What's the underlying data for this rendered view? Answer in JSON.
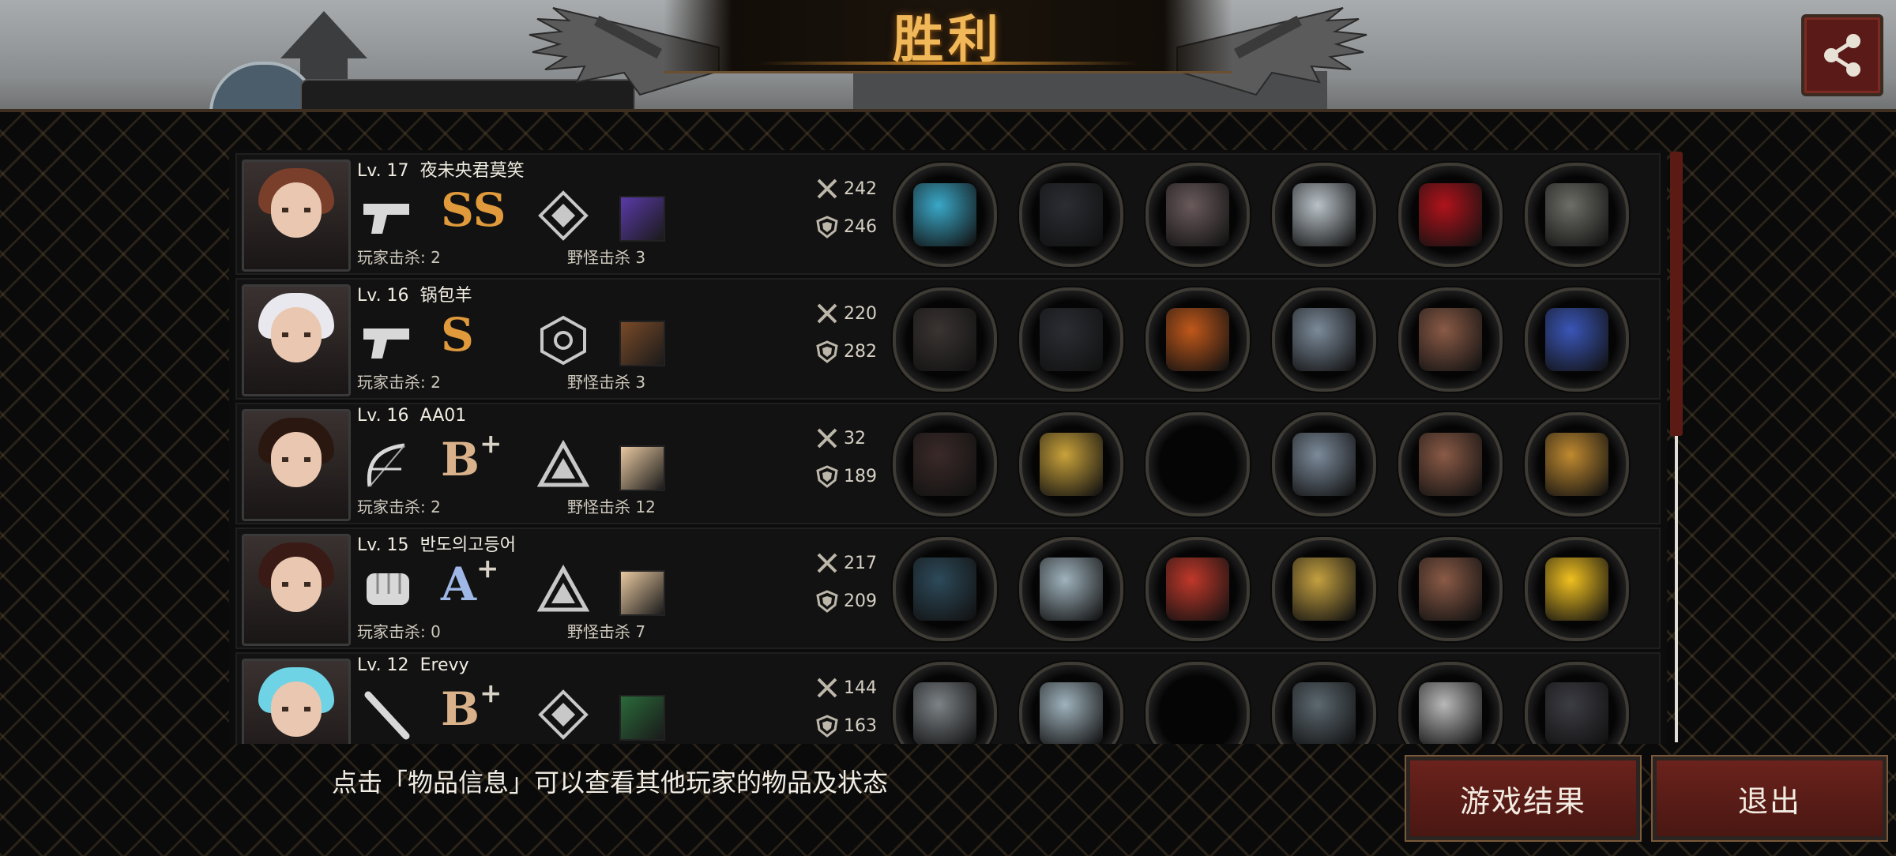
{
  "title": "胜利",
  "header_partial_name": "夜未央君莫笑",
  "players": [
    {
      "lv_label": "Lv. 17",
      "name": "夜未央君莫笑",
      "grade": "SS",
      "grade_plus": "",
      "weapon_icon": "pistol-icon",
      "rank_icon": "diamond-rank-icon",
      "player_kills": "玩家击杀: 2",
      "monster_kills": "野怪击杀 3",
      "attack": "242",
      "defense": "246",
      "slots": [
        "laser-rifle",
        "black-helmet",
        "stone-armor",
        "silver-spike",
        "red-heels",
        "grey-book"
      ]
    },
    {
      "lv_label": "Lv. 16",
      "name": "锅包羊",
      "grade": "S",
      "grade_plus": "",
      "weapon_icon": "pistol-icon",
      "rank_icon": "hexagon-rank-icon",
      "player_kills": "玩家击杀: 2",
      "monster_kills": "野怪击杀 3",
      "attack": "220",
      "defense": "282",
      "slots": [
        "revolver",
        "black-helmet",
        "flame-armor",
        "watch",
        "bracer",
        "galaxy"
      ]
    },
    {
      "lv_label": "Lv. 16",
      "name": "AA01",
      "grade": "B",
      "grade_plus": "+",
      "weapon_icon": "bow-icon",
      "rank_icon": "triangle-rank-icon",
      "player_kills": "玩家击杀: 2",
      "monster_kills": "野怪击杀 12",
      "attack": "32",
      "defense": "189",
      "slots": [
        "crossbow",
        "crown",
        "empty",
        "watch",
        "bracer",
        "earrings"
      ]
    },
    {
      "lv_label": "Lv. 15",
      "name": "반도의고등어",
      "grade": "A",
      "grade_plus": "+",
      "weapon_icon": "fist-icon",
      "rank_icon": "triangle-rank-icon",
      "player_kills": "玩家击杀: 0",
      "monster_kills": "野怪击杀 7",
      "attack": "217",
      "defense": "209",
      "slots": [
        "dragon-claw",
        "silver-helmet",
        "red-jacket",
        "gold-shield",
        "bracer",
        "lily"
      ]
    },
    {
      "lv_label": "Lv. 12",
      "name": "Erevy",
      "grade": "B",
      "grade_plus": "+",
      "weapon_icon": "bat-icon",
      "rank_icon": "diamond-rank-icon",
      "player_kills": "",
      "monster_kills": "",
      "attack": "144",
      "defense": "163",
      "slots": [
        "grey-spear",
        "silver-helmet",
        "empty",
        "spiked-gauntlet",
        "armored-boots",
        "dark-flag"
      ]
    }
  ],
  "hint": "点击「物品信息」可以查看其他玩家的物品及状态",
  "buttons": {
    "results": "游戏结果",
    "exit": "退出"
  },
  "colors": {
    "title_gold": "#f1b85a",
    "button_red": "#5a1b18",
    "grade_ss": "#e09a3b"
  }
}
